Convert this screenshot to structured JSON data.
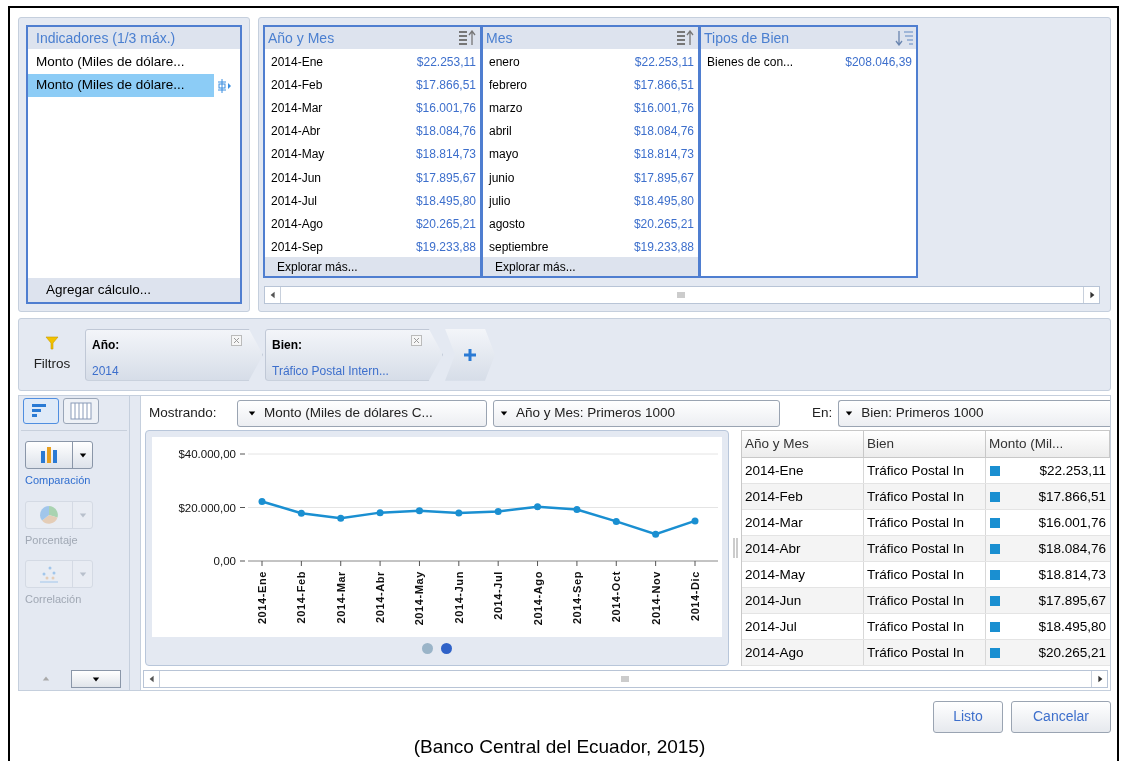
{
  "indicators": {
    "title": "Indicadores (1/3 máx.)",
    "items": [
      {
        "label": "Monto (Miles de dólare...",
        "selected": false
      },
      {
        "label": "Monto (Miles de dólare...",
        "selected": true
      }
    ],
    "add_calculation": "Agregar cálculo..."
  },
  "pivot_columns": [
    {
      "title": "Año y Mes",
      "kind": "ascending",
      "footer": "Explorar más...",
      "rows": [
        {
          "label": "2014-Ene",
          "value": "$22.253,11"
        },
        {
          "label": "2014-Feb",
          "value": "$17.866,51"
        },
        {
          "label": "2014-Mar",
          "value": "$16.001,76"
        },
        {
          "label": "2014-Abr",
          "value": "$18.084,76"
        },
        {
          "label": "2014-May",
          "value": "$18.814,73"
        },
        {
          "label": "2014-Jun",
          "value": "$17.895,67"
        },
        {
          "label": "2014-Jul",
          "value": "$18.495,80"
        },
        {
          "label": "2014-Ago",
          "value": "$20.265,21"
        },
        {
          "label": "2014-Sep",
          "value": "$19.233,88"
        }
      ]
    },
    {
      "title": "Mes",
      "kind": "ascending",
      "footer": "Explorar más...",
      "rows": [
        {
          "label": "enero",
          "value": "$22.253,11"
        },
        {
          "label": "febrero",
          "value": "$17.866,51"
        },
        {
          "label": "marzo",
          "value": "$16.001,76"
        },
        {
          "label": "abril",
          "value": "$18.084,76"
        },
        {
          "label": "mayo",
          "value": "$18.814,73"
        },
        {
          "label": "junio",
          "value": "$17.895,67"
        },
        {
          "label": "julio",
          "value": "$18.495,80"
        },
        {
          "label": "agosto",
          "value": "$20.265,21"
        },
        {
          "label": "septiembre",
          "value": "$19.233,88"
        }
      ]
    },
    {
      "title": "Tipos de Bien",
      "kind": "descending",
      "rows": [
        {
          "label": "Bienes de con...",
          "value": "$208.046,39"
        }
      ]
    }
  ],
  "filters": {
    "label": "Filtros",
    "chips": [
      {
        "name": "Año:",
        "value": "2014"
      },
      {
        "name": "Bien:",
        "value": "Tráfico Postal Intern..."
      }
    ]
  },
  "view_toggles": [
    {
      "kind": "chart",
      "selected": true
    },
    {
      "kind": "table",
      "selected": false
    }
  ],
  "chart_types": [
    {
      "kind": "bar",
      "label": "Comparación",
      "disabled": false
    },
    {
      "kind": "pie",
      "label": "Porcentaje",
      "disabled": true
    },
    {
      "kind": "scatter",
      "label": "Correlación",
      "disabled": true
    }
  ],
  "toolbar": {
    "showing_label": "Mostrando:",
    "measure": "Monto (Miles de dólares C...",
    "rows_by": "Año y Mes: Primeros 1000",
    "in_label": "En:",
    "in_value": "Bien: Primeros 1000"
  },
  "chart": {
    "chart_data": {
      "type": "line",
      "categories": [
        "2014-Ene",
        "2014-Feb",
        "2014-Mar",
        "2014-Abr",
        "2014-May",
        "2014-Jun",
        "2014-Jul",
        "2014-Ago",
        "2014-Sep",
        "2014-Oct",
        "2014-Nov",
        "2014-Dic"
      ],
      "series": [
        {
          "color": "#1a8fd1",
          "marker": true,
          "values": [
            22250,
            17870,
            16000,
            18080,
            18810,
            17900,
            18500,
            20270,
            19230,
            14800,
            10000,
            15000
          ]
        }
      ],
      "ylim": [
        0,
        40000
      ],
      "yticks": [
        {
          "value": 0,
          "label": "0,00"
        },
        {
          "value": 20000,
          "label": "$20.000,00"
        },
        {
          "value": 40000,
          "label": "$40.000,00"
        }
      ]
    },
    "pages": [
      {
        "selected": false
      },
      {
        "selected": true
      }
    ]
  },
  "table": {
    "columns": [
      "Año y Mes",
      "Bien",
      "Monto (Mil..."
    ],
    "rows": [
      {
        "month": "2014-Ene",
        "item": "Tráfico Postal In",
        "amount": "$22.253,11"
      },
      {
        "month": "2014-Feb",
        "item": "Tráfico Postal In",
        "amount": "$17.866,51"
      },
      {
        "month": "2014-Mar",
        "item": "Tráfico Postal In",
        "amount": "$16.001,76"
      },
      {
        "month": "2014-Abr",
        "item": "Tráfico Postal In",
        "amount": "$18.084,76"
      },
      {
        "month": "2014-May",
        "item": "Tráfico Postal In",
        "amount": "$18.814,73"
      },
      {
        "month": "2014-Jun",
        "item": "Tráfico Postal In",
        "amount": "$17.895,67"
      },
      {
        "month": "2014-Jul",
        "item": "Tráfico Postal In",
        "amount": "$18.495,80"
      },
      {
        "month": "2014-Ago",
        "item": "Tráfico Postal In",
        "amount": "$20.265,21"
      }
    ]
  },
  "buttons": [
    "Listo",
    "Cancelar"
  ],
  "caption": "(Banco Central del Ecuador, 2015)"
}
